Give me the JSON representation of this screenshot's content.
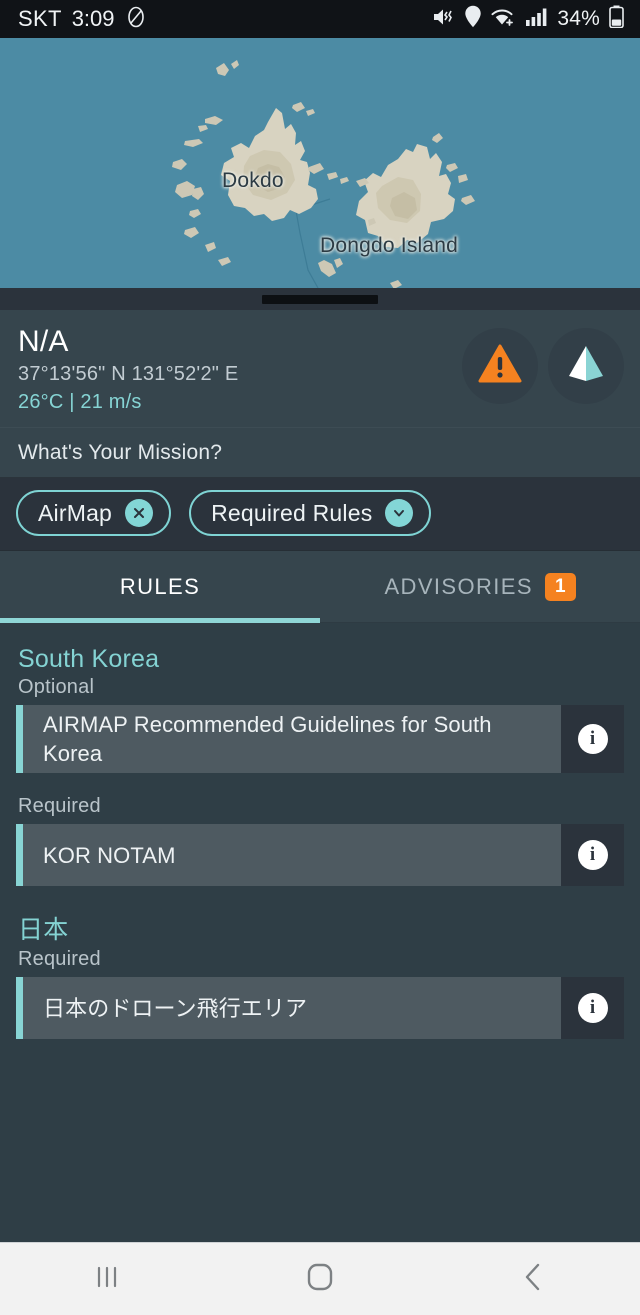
{
  "status_bar": {
    "carrier": "SKT",
    "time": "3:09",
    "battery_percent": "34%",
    "icons": [
      "dnd-icon",
      "mute-vibrate-icon",
      "location-pin-icon",
      "wifi-icon",
      "signal-bars-icon",
      "battery-icon"
    ]
  },
  "map": {
    "labels": [
      {
        "name": "Dokdo"
      },
      {
        "name": "Dongdo Island"
      }
    ],
    "sea_color": "#4c8ba4",
    "land_color": "#d7d2c0"
  },
  "info_panel": {
    "title": "N/A",
    "coordinates": "37°13'56\" N  131°52'2\" E",
    "weather": "26°C | 21 m/s",
    "warning_button": "warning-triangle-icon",
    "flight_button": "paper-plane-icon",
    "warning_color": "#f58220",
    "accent_color": "#8ad4d4"
  },
  "mission": {
    "label": "What's Your Mission?",
    "chips": [
      {
        "label": "AirMap",
        "icon": "close-x-icon"
      },
      {
        "label": "Required Rules",
        "icon": "chevron-down-icon"
      }
    ]
  },
  "tabs": [
    {
      "label": "RULES",
      "active": true,
      "badge": ""
    },
    {
      "label": "ADVISORIES",
      "active": false,
      "badge": "1"
    }
  ],
  "rules_sections": [
    {
      "country": "South Korea",
      "groups": [
        {
          "requirement": "Optional",
          "rules": [
            {
              "title": "AIRMAP Recommended Guidelines for South Korea",
              "info": "i"
            }
          ]
        },
        {
          "requirement": "Required",
          "rules": [
            {
              "title": "KOR NOTAM",
              "info": "i"
            }
          ]
        }
      ]
    },
    {
      "country": "日本",
      "groups": [
        {
          "requirement": "Required",
          "rules": [
            {
              "title": "日本のドローン飛行エリア",
              "info": "i"
            }
          ]
        }
      ]
    }
  ],
  "nav_bar": {
    "recents": "recents-icon",
    "home": "home-icon",
    "back": "back-icon"
  }
}
